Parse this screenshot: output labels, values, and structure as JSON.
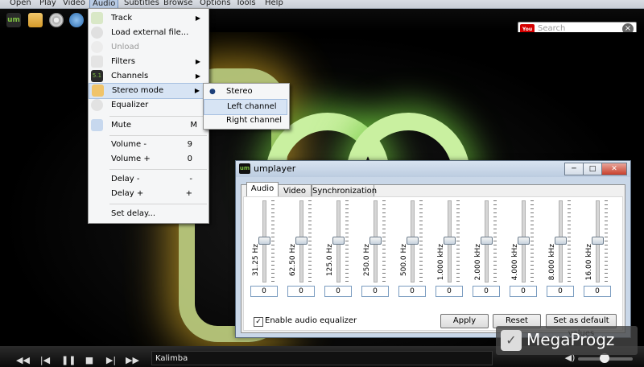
{
  "menubar": {
    "items": [
      "Open",
      "Play",
      "Video",
      "Audio",
      "Subtitles",
      "Browse",
      "Options",
      "Tools",
      "Help"
    ]
  },
  "search": {
    "placeholder": "Search",
    "badge": "You Tube"
  },
  "audio_menu": {
    "items": [
      {
        "label": "Track",
        "submenu": true,
        "icon": "track-icon"
      },
      {
        "label": "Load external file...",
        "icon": "load-file-icon"
      },
      {
        "label": "Unload",
        "disabled": true,
        "icon": "unload-icon"
      },
      {
        "label": "Filters",
        "submenu": true,
        "icon": "filters-icon"
      },
      {
        "label": "Channels",
        "submenu": true,
        "icon": "channels-icon"
      },
      {
        "label": "Stereo mode",
        "submenu": true,
        "icon": "stereo-mode-icon"
      },
      {
        "label": "Equalizer",
        "icon": "equalizer-icon"
      },
      {
        "label": "Mute",
        "shortcut": "M",
        "icon": "mute-icon"
      },
      {
        "label": "Volume -",
        "shortcut": "9"
      },
      {
        "label": "Volume +",
        "shortcut": "0"
      },
      {
        "label": "Delay -",
        "shortcut": "-"
      },
      {
        "label": "Delay +",
        "shortcut": "+"
      },
      {
        "label": "Set delay..."
      }
    ]
  },
  "stereo_submenu": {
    "items": [
      {
        "label": "Stereo",
        "checked": true
      },
      {
        "label": "Left channel"
      },
      {
        "label": "Right channel"
      }
    ]
  },
  "dialog": {
    "title": "umplayer",
    "icon_text": "um",
    "tabs": [
      "Audio",
      "Video",
      "Synchronization"
    ],
    "bands": [
      {
        "label": "31.25 Hz",
        "value": "0"
      },
      {
        "label": "62.50 Hz",
        "value": "0"
      },
      {
        "label": "125.0 Hz",
        "value": "0"
      },
      {
        "label": "250.0 Hz",
        "value": "0"
      },
      {
        "label": "500.0 Hz",
        "value": "0"
      },
      {
        "label": "1.000 kHz",
        "value": "0"
      },
      {
        "label": "2.000 kHz",
        "value": "0"
      },
      {
        "label": "4.000 kHz",
        "value": "0"
      },
      {
        "label": "8.000 kHz",
        "value": "0"
      },
      {
        "label": "16.00 kHz",
        "value": "0"
      }
    ],
    "enable_label": "Enable audio equalizer",
    "enable_checked": true,
    "apply_label": "Apply",
    "reset_label": "Reset",
    "default_label": "Set as default values"
  },
  "player": {
    "now_playing": "Kalimba"
  },
  "watermark": {
    "text": "MegaProgz"
  },
  "colors": {
    "accent": "#7ec242",
    "menu_highlight": "#d7e4f4",
    "youtube_red": "#d40000"
  }
}
